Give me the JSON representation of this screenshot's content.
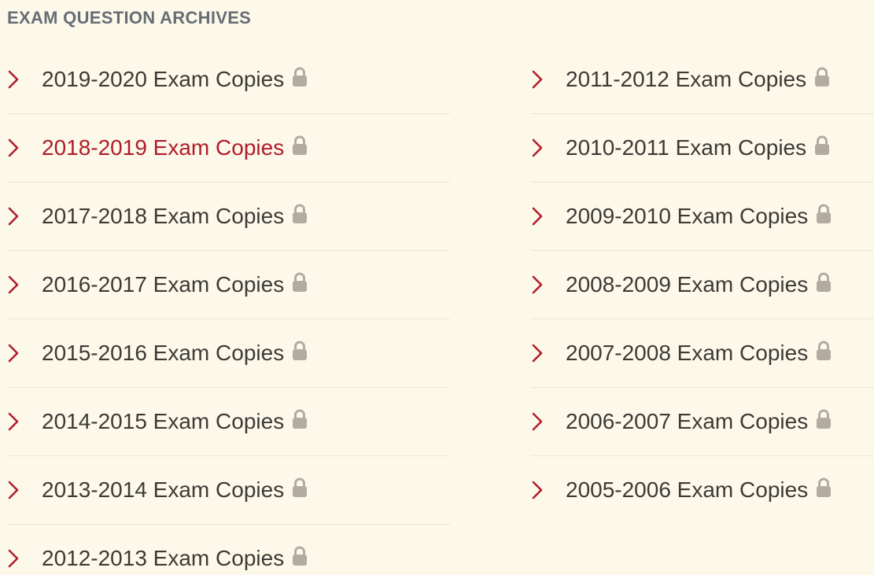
{
  "heading": "EXAM QUESTION ARCHIVES",
  "colors": {
    "background": "#fdf9ea",
    "accent": "#b01d2a",
    "text": "#3d3a36",
    "lock": "#b3aaa2",
    "heading": "#676d74"
  },
  "columns": [
    {
      "items": [
        {
          "label": "2019-2020 Exam Copies",
          "icon": "lock-icon",
          "active": false
        },
        {
          "label": "2018-2019 Exam Copies",
          "icon": "lock-icon",
          "active": true
        },
        {
          "label": "2017-2018 Exam Copies",
          "icon": "lock-icon",
          "active": false
        },
        {
          "label": "2016-2017 Exam Copies",
          "icon": "lock-icon",
          "active": false
        },
        {
          "label": "2015-2016 Exam Copies",
          "icon": "lock-icon",
          "active": false
        },
        {
          "label": "2014-2015 Exam Copies",
          "icon": "lock-icon",
          "active": false
        },
        {
          "label": "2013-2014 Exam Copies",
          "icon": "lock-icon",
          "active": false
        },
        {
          "label": "2012-2013 Exam Copies",
          "icon": "lock-icon",
          "active": false
        }
      ]
    },
    {
      "items": [
        {
          "label": "2011-2012 Exam Copies",
          "icon": "lock-icon",
          "active": false
        },
        {
          "label": "2010-2011 Exam Copies",
          "icon": "lock-icon",
          "active": false
        },
        {
          "label": "2009-2010 Exam Copies",
          "icon": "lock-icon",
          "active": false
        },
        {
          "label": "2008-2009 Exam Copies",
          "icon": "lock-icon",
          "active": false
        },
        {
          "label": "2007-2008 Exam Copies",
          "icon": "lock-icon",
          "active": false
        },
        {
          "label": "2006-2007 Exam Copies",
          "icon": "lock-icon",
          "active": false
        },
        {
          "label": "2005-2006 Exam Copies",
          "icon": "lock-icon",
          "active": false
        }
      ]
    }
  ]
}
